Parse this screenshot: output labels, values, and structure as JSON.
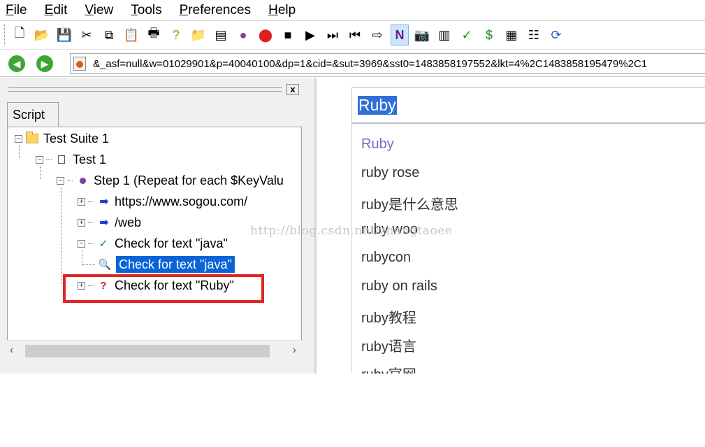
{
  "menu": [
    {
      "acc": "F",
      "rest": "ile"
    },
    {
      "acc": "E",
      "rest": "dit"
    },
    {
      "acc": "V",
      "rest": "iew"
    },
    {
      "acc": "T",
      "rest": "ools"
    },
    {
      "acc": "P",
      "rest": "references"
    },
    {
      "acc": "H",
      "rest": "elp"
    }
  ],
  "toolbar": {
    "icons": [
      "new-file-icon",
      "open-folder-icon",
      "save-icon",
      "cut-icon",
      "copy-icon",
      "paste-icon",
      "print-icon",
      "help-icon",
      "add-folder-icon",
      "add-test-icon",
      "add-step-icon",
      "record-icon",
      "stop-icon",
      "play-icon",
      "fast-forward-icon",
      "step-back-icon",
      "skip-icon",
      "n-icon",
      "camera-icon",
      "list-icon",
      "check-icon",
      "dollar-icon",
      "grid-icon",
      "tree-icon",
      "refresh-icon"
    ],
    "glyphs": [
      "🗋",
      "📂",
      "💾",
      "✂",
      "⧉",
      "📋",
      "🖶",
      "?",
      "📁",
      "▤",
      "●",
      "⬤",
      "■",
      "▶",
      "⏭",
      "⏮",
      "⇨",
      "N",
      "📷",
      "▥",
      "✓",
      "$",
      "▦",
      "☷",
      "⟳"
    ]
  },
  "address": {
    "url": "&_asf=null&w=01029901&p=40040100&dp=1&cid=&sut=3969&sst0=1483858197552&lkt=4%2C1483858195479%2C1"
  },
  "left_pane": {
    "tab_label": "Script",
    "close_label": "x",
    "tree": {
      "suite": "Test Suite 1",
      "test": "Test 1",
      "step": "Step 1 (Repeat for each $KeyValu",
      "url1": "https://www.sogou.com/",
      "url2": "/web",
      "check_java": "Check for text \"java\"",
      "check_java_child": "Check for text \"java\"",
      "check_ruby": "Check for text \"Ruby\""
    }
  },
  "browser": {
    "search_value": "Ruby",
    "suggestions": [
      "Ruby",
      "ruby rose",
      "ruby是什么意思",
      "ruby woo",
      "rubycon",
      "ruby on rails",
      "ruby教程",
      "ruby语言",
      "ruby官网"
    ]
  },
  "watermark": "http://blog.csdn.net/zhangtaoee",
  "colors": {
    "selection": "#0a64d6",
    "highlight_box": "#e02525",
    "nav_green": "#3fa535"
  }
}
